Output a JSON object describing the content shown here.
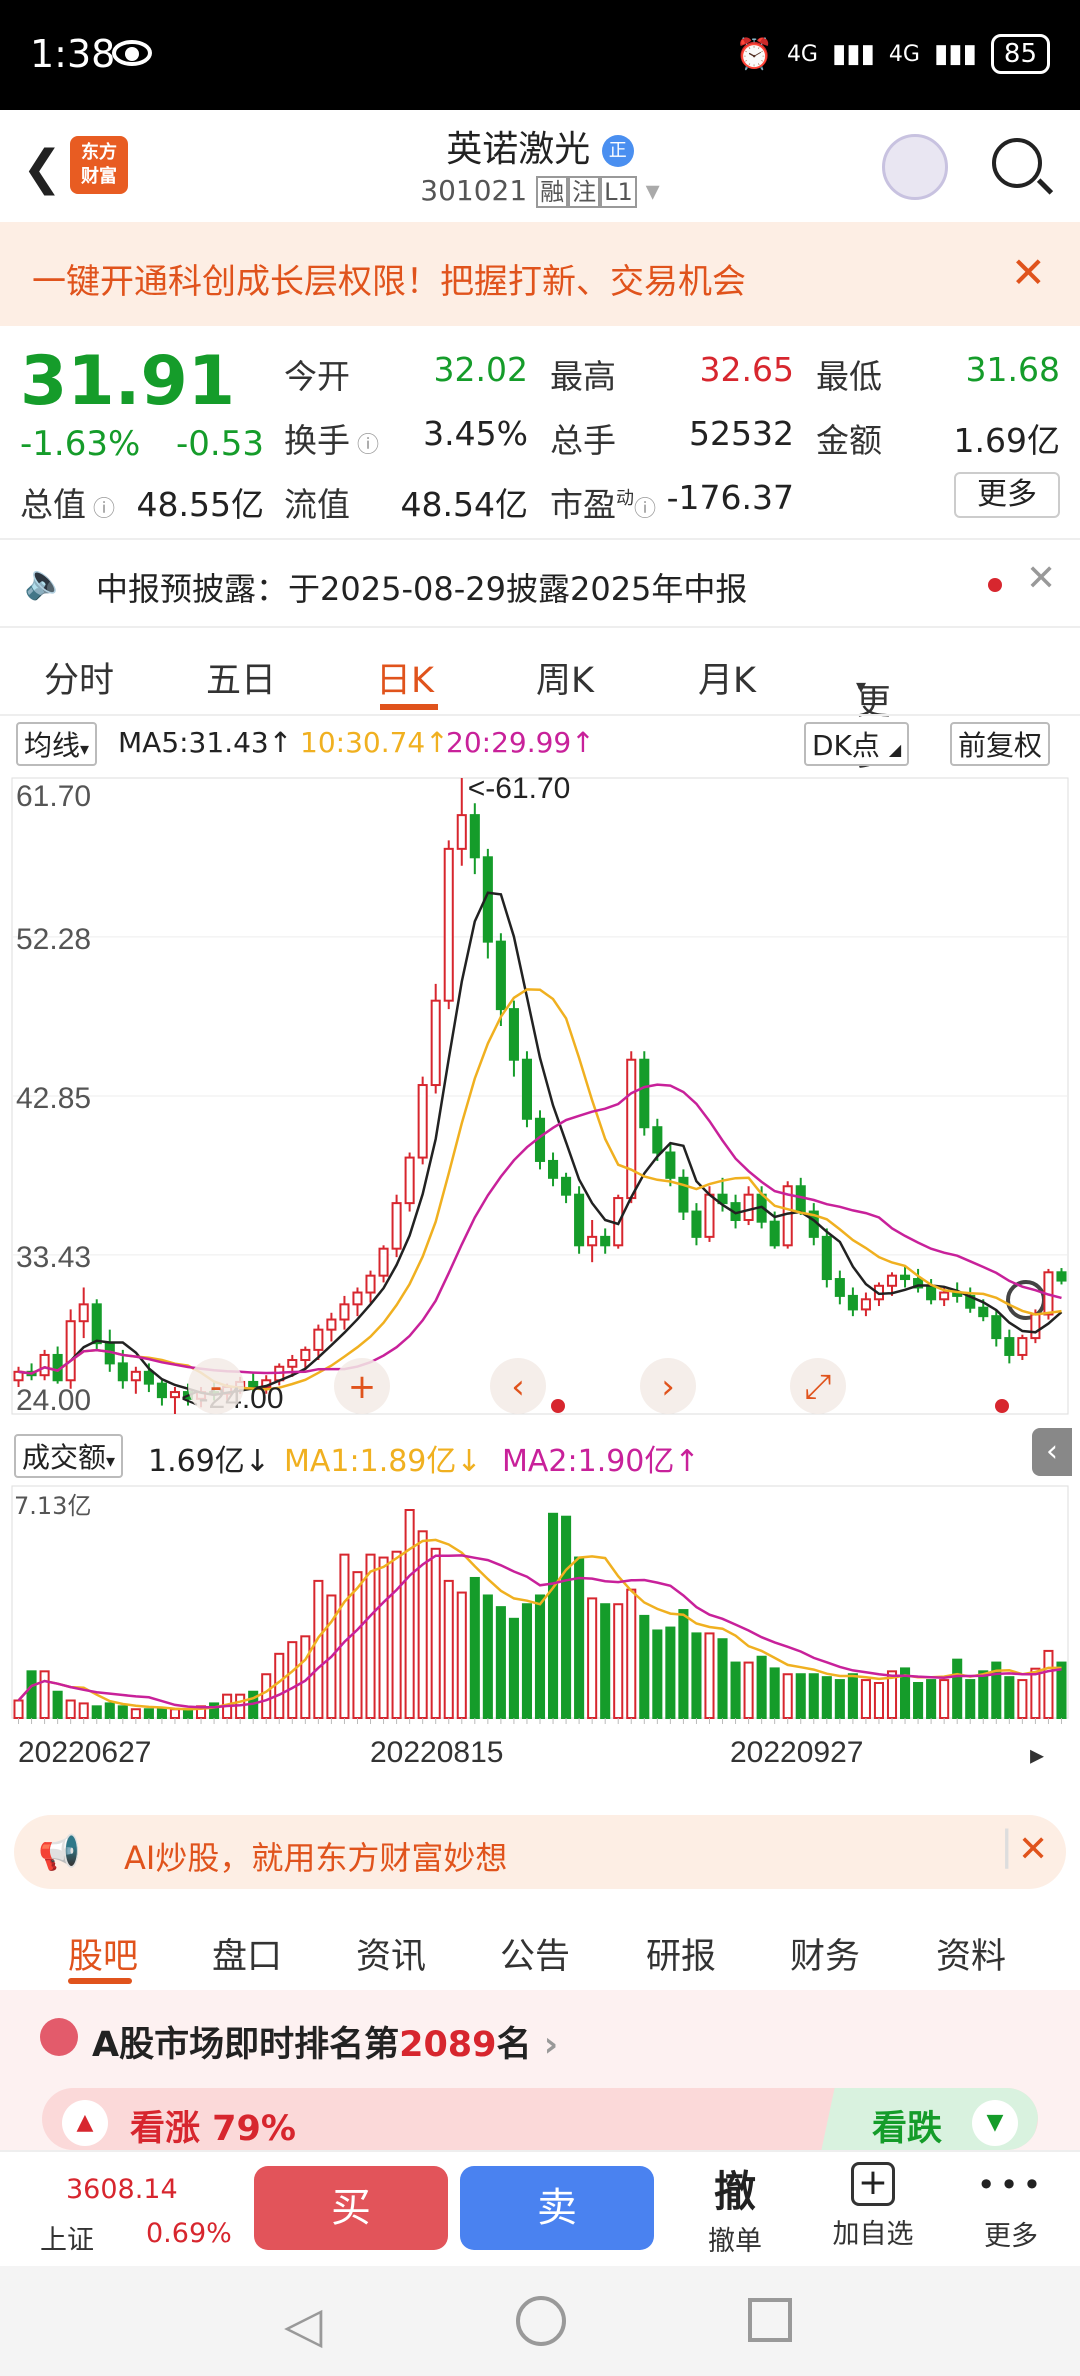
{
  "status": {
    "time": "1:38",
    "battery": "85",
    "net1": "4G",
    "net2": "4G"
  },
  "header": {
    "title": "英诺激光",
    "code": "301021",
    "tag1": "融",
    "tag2": "注",
    "tag3": "L1",
    "logo_l1": "东方",
    "logo_l2": "财富",
    "badge": "正"
  },
  "promo": {
    "text": "一键开通科创成长层权限！把握打新、交易机会"
  },
  "quote": {
    "price": "31.91",
    "pct": "-1.63%",
    "chg": "-0.53",
    "open_l": "今开",
    "open_v": "32.02",
    "high_l": "最高",
    "high_v": "32.65",
    "low_l": "最低",
    "low_v": "31.68",
    "turn_l": "换手",
    "turn_v": "3.45%",
    "vol_l": "总手",
    "vol_v": "52532",
    "amt_l": "金额",
    "amt_v": "1.69亿",
    "mcap_l": "总值",
    "mcap_v": "48.55亿",
    "fcap_l": "流值",
    "fcap_v": "48.54亿",
    "pe_l": "市盈",
    "pe_sup": "动",
    "pe_v": "-176.37",
    "more": "更多"
  },
  "notice": {
    "text": "中报预披露：于2025-08-29披露2025年中报"
  },
  "tabs": [
    "分时",
    "五日",
    "日K",
    "周K",
    "月K",
    "更多"
  ],
  "ma": {
    "sel": "均线",
    "ma5": "MA5:31.43↑",
    "ma10": "10:30.74↑",
    "ma20": "20:29.99↑",
    "dk": "DK点",
    "adj": "前复权"
  },
  "vol": {
    "sel": "成交额",
    "v": "1.69亿↓",
    "ma1": "MA1:1.89亿↓",
    "ma2": "MA2:1.90亿↑",
    "ymax": "7.13亿"
  },
  "ai": {
    "text": "AI炒股，就用东方财富妙想"
  },
  "btabs": [
    "股吧",
    "盘口",
    "资讯",
    "公告",
    "研报",
    "财务",
    "资料"
  ],
  "rank": {
    "pre": "A股市场即时排名第",
    "num": "2089",
    "post": "名",
    "up": "看涨 79%",
    "down": "看跌"
  },
  "bottom": {
    "idx": "3608.14",
    "idxname": "上证",
    "idxpct": "0.69%",
    "buy": "买",
    "sell": "卖",
    "cancel_icon": "撤",
    "cancel": "撤单",
    "add": "加自选",
    "more": "更多"
  },
  "colors": {
    "up": "#d7262e",
    "down": "#159c2a",
    "accent": "#e0531c",
    "ma5": "#222222",
    "ma10": "#f0b020",
    "ma20": "#c8219a"
  },
  "chart_data": {
    "type": "candlestick",
    "y_ticks": [
      "61.70",
      "52.28",
      "42.85",
      "33.43",
      "24.00"
    ],
    "ylim": [
      24.0,
      61.7
    ],
    "x_labels": [
      "20220627",
      "20220815",
      "20220927"
    ],
    "max_label": "<-61.70",
    "min_label": "<-24.00",
    "candles": [
      [
        26,
        26.8,
        25.6,
        26.5
      ],
      [
        26.5,
        27,
        26,
        26.3
      ],
      [
        26.3,
        27.8,
        26,
        27.5
      ],
      [
        27.5,
        28,
        25.8,
        26
      ],
      [
        26,
        30.2,
        25.5,
        29.5
      ],
      [
        29.5,
        31.5,
        28.5,
        30.5
      ],
      [
        30.5,
        30.8,
        27.8,
        28.2
      ],
      [
        28.2,
        29,
        26.5,
        27
      ],
      [
        27,
        27.8,
        25.5,
        26
      ],
      [
        26,
        26.8,
        25.2,
        26.5
      ],
      [
        26.5,
        27,
        25.3,
        25.8
      ],
      [
        25.8,
        26,
        24.5,
        25
      ],
      [
        25,
        25.6,
        24,
        25.3
      ],
      [
        25.3,
        25.8,
        24.5,
        24.9
      ],
      [
        24.9,
        25.6,
        24.4,
        25.3
      ],
      [
        25.3,
        25.9,
        24.8,
        25.2
      ],
      [
        25.2,
        25.8,
        24.8,
        25.6
      ],
      [
        25.6,
        26.2,
        25.2,
        25.9
      ],
      [
        25.9,
        26.4,
        25.3,
        25.6
      ],
      [
        25.6,
        26.3,
        25.2,
        26
      ],
      [
        26,
        27,
        25.7,
        26.8
      ],
      [
        26.8,
        27.5,
        26.2,
        27.2
      ],
      [
        27.2,
        28,
        26.6,
        27.8
      ],
      [
        27.8,
        29.3,
        27.2,
        29
      ],
      [
        29,
        30,
        28.3,
        29.6
      ],
      [
        29.6,
        31,
        29,
        30.5
      ],
      [
        30.5,
        31.5,
        29.8,
        31.2
      ],
      [
        31.2,
        32.5,
        30.6,
        32.2
      ],
      [
        32.2,
        34,
        31.8,
        33.8
      ],
      [
        33.8,
        37,
        33.3,
        36.5
      ],
      [
        36.5,
        39.5,
        36,
        39.2
      ],
      [
        39.2,
        44,
        38.8,
        43.5
      ],
      [
        43.5,
        49.5,
        43,
        48.5
      ],
      [
        48.5,
        58,
        48,
        57.5
      ],
      [
        57.5,
        61.7,
        56.5,
        59.5
      ],
      [
        59.5,
        60.2,
        56,
        57
      ],
      [
        57,
        57.5,
        51,
        52
      ],
      [
        52,
        52.5,
        47,
        48
      ],
      [
        48,
        48.5,
        44,
        45
      ],
      [
        45,
        45.5,
        41,
        41.5
      ],
      [
        41.5,
        42,
        38.5,
        39
      ],
      [
        39,
        39.5,
        37.5,
        38
      ],
      [
        38,
        38.3,
        36.5,
        37
      ],
      [
        37,
        37.5,
        33.5,
        34
      ],
      [
        34,
        35.5,
        33,
        34.5
      ],
      [
        34.5,
        35,
        33.5,
        34
      ],
      [
        34,
        37,
        33.8,
        36.8
      ],
      [
        36.8,
        45.5,
        36.5,
        45
      ],
      [
        45,
        45.5,
        40.5,
        41
      ],
      [
        41,
        41.5,
        39,
        39.5
      ],
      [
        39.5,
        40,
        37.5,
        38
      ],
      [
        38,
        38.5,
        35.5,
        36
      ],
      [
        36,
        36.5,
        34,
        34.5
      ],
      [
        34.5,
        37.5,
        34.2,
        37
      ],
      [
        37,
        38,
        36,
        36.5
      ],
      [
        36.5,
        37,
        35,
        35.5
      ],
      [
        35.5,
        37.5,
        35.2,
        37
      ],
      [
        37,
        37.5,
        35,
        35.4
      ],
      [
        35.4,
        36,
        33.8,
        34
      ],
      [
        34,
        37.8,
        33.8,
        37.5
      ],
      [
        37.5,
        38,
        35.8,
        36
      ],
      [
        36,
        36.5,
        34,
        34.5
      ],
      [
        34.5,
        35,
        31.5,
        32
      ],
      [
        32,
        32.5,
        30.5,
        31
      ],
      [
        31,
        31.5,
        29.8,
        30.2
      ],
      [
        30.2,
        31.2,
        29.8,
        30.8
      ],
      [
        30.8,
        31.8,
        30.4,
        31.6
      ],
      [
        31.6,
        32.4,
        31,
        32.2
      ],
      [
        32.2,
        32.8,
        31.5,
        32
      ],
      [
        32,
        32.6,
        31.2,
        31.5
      ],
      [
        31.5,
        32,
        30.5,
        30.8
      ],
      [
        30.8,
        31.5,
        30.4,
        31.2
      ],
      [
        31.2,
        31.8,
        30.6,
        31
      ],
      [
        31,
        31.5,
        30,
        30.3
      ],
      [
        30.3,
        30.8,
        29.5,
        29.8
      ],
      [
        29.8,
        30.2,
        28,
        28.5
      ],
      [
        28.5,
        29,
        27,
        27.5
      ],
      [
        27.5,
        28.7,
        27.2,
        28.5
      ],
      [
        28.5,
        30.2,
        28.2,
        29.9
      ],
      [
        29.9,
        32.6,
        29.6,
        32.4
      ],
      [
        32.4,
        32.65,
        31.68,
        31.91
      ]
    ],
    "volumes": [
      0.6,
      1.6,
      1.6,
      0.9,
      0.6,
      0.5,
      0.4,
      0.5,
      0.4,
      0.3,
      0.3,
      0.3,
      0.3,
      0.3,
      0.4,
      0.5,
      0.8,
      0.8,
      0.9,
      1.5,
      2.2,
      2.6,
      2.8,
      4.7,
      4.2,
      5.6,
      5.0,
      5.6,
      5.5,
      5.7,
      7.13,
      6.4,
      5.8,
      4.7,
      4.3,
      4.8,
      4.2,
      3.8,
      3.4,
      3.9,
      4.2,
      7.0,
      6.9,
      5.5,
      4.1,
      3.9,
      3.9,
      4.4,
      3.5,
      3.0,
      3.1,
      3.7,
      2.9,
      2.9,
      2.7,
      1.9,
      1.9,
      2.1,
      1.7,
      1.5,
      1.5,
      1.5,
      1.4,
      1.3,
      1.5,
      1.3,
      1.2,
      1.6,
      1.7,
      1.2,
      1.3,
      1.3,
      2.0,
      1.3,
      1.6,
      1.9,
      1.4,
      1.3,
      1.69,
      2.3,
      1.9
    ]
  }
}
